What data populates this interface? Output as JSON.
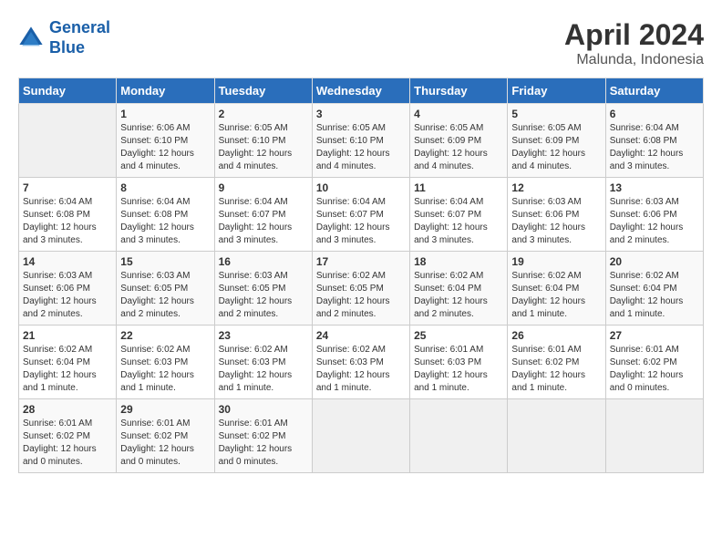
{
  "header": {
    "logo_line1": "General",
    "logo_line2": "Blue",
    "title": "April 2024",
    "subtitle": "Malunda, Indonesia"
  },
  "days_of_week": [
    "Sunday",
    "Monday",
    "Tuesday",
    "Wednesday",
    "Thursday",
    "Friday",
    "Saturday"
  ],
  "weeks": [
    [
      {
        "num": "",
        "info": ""
      },
      {
        "num": "1",
        "info": "Sunrise: 6:06 AM\nSunset: 6:10 PM\nDaylight: 12 hours\nand 4 minutes."
      },
      {
        "num": "2",
        "info": "Sunrise: 6:05 AM\nSunset: 6:10 PM\nDaylight: 12 hours\nand 4 minutes."
      },
      {
        "num": "3",
        "info": "Sunrise: 6:05 AM\nSunset: 6:10 PM\nDaylight: 12 hours\nand 4 minutes."
      },
      {
        "num": "4",
        "info": "Sunrise: 6:05 AM\nSunset: 6:09 PM\nDaylight: 12 hours\nand 4 minutes."
      },
      {
        "num": "5",
        "info": "Sunrise: 6:05 AM\nSunset: 6:09 PM\nDaylight: 12 hours\nand 4 minutes."
      },
      {
        "num": "6",
        "info": "Sunrise: 6:04 AM\nSunset: 6:08 PM\nDaylight: 12 hours\nand 3 minutes."
      }
    ],
    [
      {
        "num": "7",
        "info": "Sunrise: 6:04 AM\nSunset: 6:08 PM\nDaylight: 12 hours\nand 3 minutes."
      },
      {
        "num": "8",
        "info": "Sunrise: 6:04 AM\nSunset: 6:08 PM\nDaylight: 12 hours\nand 3 minutes."
      },
      {
        "num": "9",
        "info": "Sunrise: 6:04 AM\nSunset: 6:07 PM\nDaylight: 12 hours\nand 3 minutes."
      },
      {
        "num": "10",
        "info": "Sunrise: 6:04 AM\nSunset: 6:07 PM\nDaylight: 12 hours\nand 3 minutes."
      },
      {
        "num": "11",
        "info": "Sunrise: 6:04 AM\nSunset: 6:07 PM\nDaylight: 12 hours\nand 3 minutes."
      },
      {
        "num": "12",
        "info": "Sunrise: 6:03 AM\nSunset: 6:06 PM\nDaylight: 12 hours\nand 3 minutes."
      },
      {
        "num": "13",
        "info": "Sunrise: 6:03 AM\nSunset: 6:06 PM\nDaylight: 12 hours\nand 2 minutes."
      }
    ],
    [
      {
        "num": "14",
        "info": "Sunrise: 6:03 AM\nSunset: 6:06 PM\nDaylight: 12 hours\nand 2 minutes."
      },
      {
        "num": "15",
        "info": "Sunrise: 6:03 AM\nSunset: 6:05 PM\nDaylight: 12 hours\nand 2 minutes."
      },
      {
        "num": "16",
        "info": "Sunrise: 6:03 AM\nSunset: 6:05 PM\nDaylight: 12 hours\nand 2 minutes."
      },
      {
        "num": "17",
        "info": "Sunrise: 6:02 AM\nSunset: 6:05 PM\nDaylight: 12 hours\nand 2 minutes."
      },
      {
        "num": "18",
        "info": "Sunrise: 6:02 AM\nSunset: 6:04 PM\nDaylight: 12 hours\nand 2 minutes."
      },
      {
        "num": "19",
        "info": "Sunrise: 6:02 AM\nSunset: 6:04 PM\nDaylight: 12 hours\nand 1 minute."
      },
      {
        "num": "20",
        "info": "Sunrise: 6:02 AM\nSunset: 6:04 PM\nDaylight: 12 hours\nand 1 minute."
      }
    ],
    [
      {
        "num": "21",
        "info": "Sunrise: 6:02 AM\nSunset: 6:04 PM\nDaylight: 12 hours\nand 1 minute."
      },
      {
        "num": "22",
        "info": "Sunrise: 6:02 AM\nSunset: 6:03 PM\nDaylight: 12 hours\nand 1 minute."
      },
      {
        "num": "23",
        "info": "Sunrise: 6:02 AM\nSunset: 6:03 PM\nDaylight: 12 hours\nand 1 minute."
      },
      {
        "num": "24",
        "info": "Sunrise: 6:02 AM\nSunset: 6:03 PM\nDaylight: 12 hours\nand 1 minute."
      },
      {
        "num": "25",
        "info": "Sunrise: 6:01 AM\nSunset: 6:03 PM\nDaylight: 12 hours\nand 1 minute."
      },
      {
        "num": "26",
        "info": "Sunrise: 6:01 AM\nSunset: 6:02 PM\nDaylight: 12 hours\nand 1 minute."
      },
      {
        "num": "27",
        "info": "Sunrise: 6:01 AM\nSunset: 6:02 PM\nDaylight: 12 hours\nand 0 minutes."
      }
    ],
    [
      {
        "num": "28",
        "info": "Sunrise: 6:01 AM\nSunset: 6:02 PM\nDaylight: 12 hours\nand 0 minutes."
      },
      {
        "num": "29",
        "info": "Sunrise: 6:01 AM\nSunset: 6:02 PM\nDaylight: 12 hours\nand 0 minutes."
      },
      {
        "num": "30",
        "info": "Sunrise: 6:01 AM\nSunset: 6:02 PM\nDaylight: 12 hours\nand 0 minutes."
      },
      {
        "num": "",
        "info": ""
      },
      {
        "num": "",
        "info": ""
      },
      {
        "num": "",
        "info": ""
      },
      {
        "num": "",
        "info": ""
      }
    ]
  ]
}
